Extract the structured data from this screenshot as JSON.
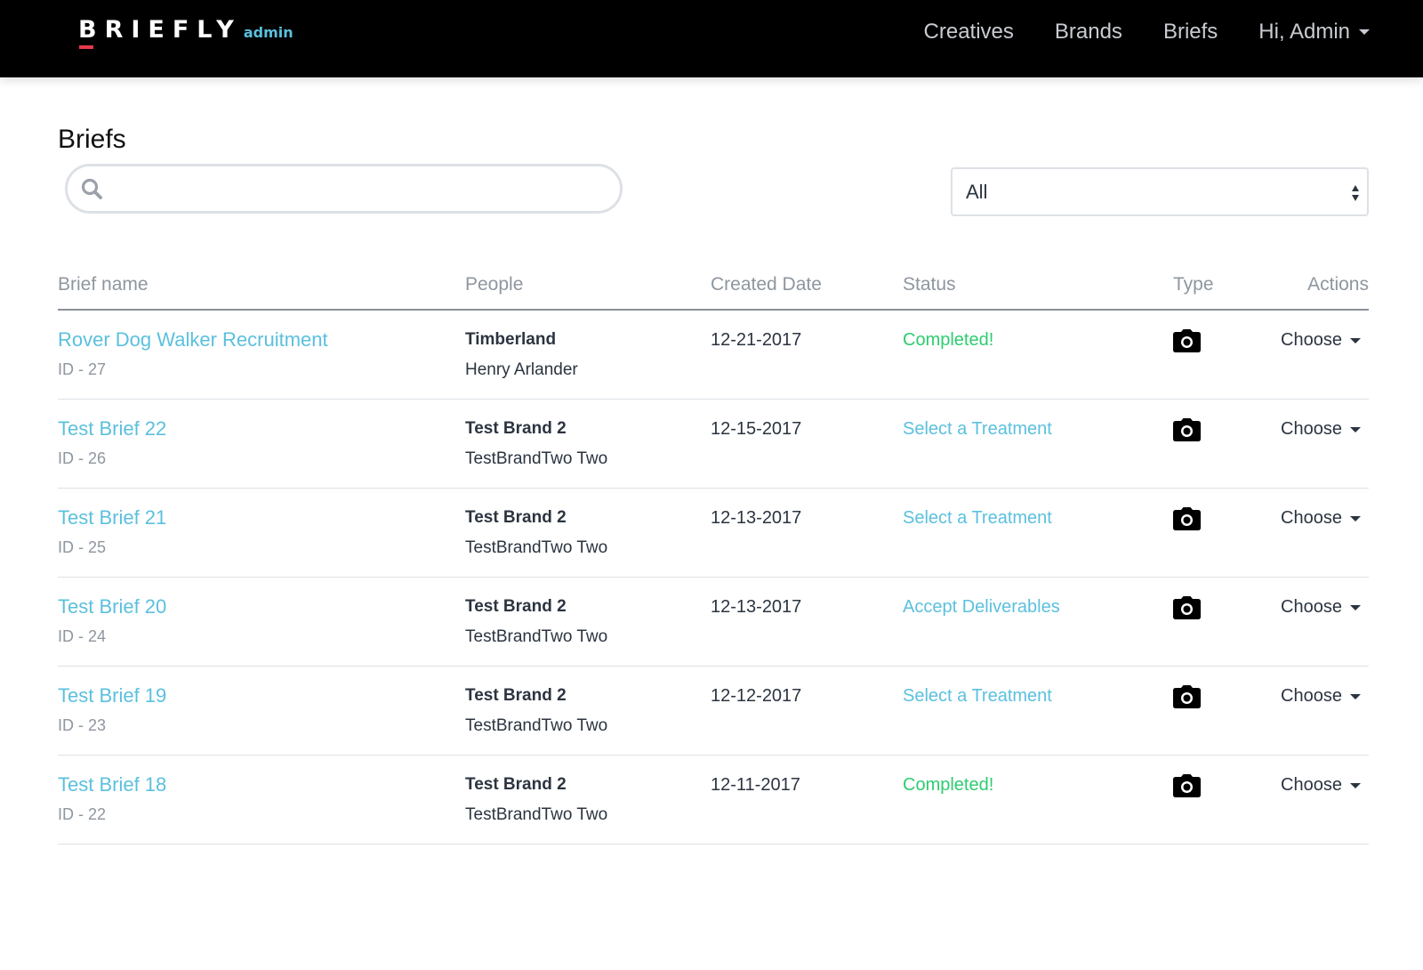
{
  "navbar": {
    "brand": "BRIEFLY",
    "brand_sub": "admin",
    "links": [
      "Creatives",
      "Brands",
      "Briefs"
    ],
    "user_menu": "Hi, Admin"
  },
  "page": {
    "title": "Briefs"
  },
  "search": {
    "placeholder": "",
    "value": ""
  },
  "filter": {
    "selected": "All"
  },
  "table": {
    "headers": {
      "name": "Brief name",
      "people": "People",
      "created": "Created Date",
      "status": "Status",
      "type": "Type",
      "actions": "Actions"
    },
    "rows": [
      {
        "name": "Rover Dog Walker Recruitment",
        "id": "ID - 27",
        "brand": "Timberland",
        "person": "Henry Arlander",
        "date": "12-21-2017",
        "status": "Completed!",
        "status_kind": "completed",
        "type_icon": "camera-icon",
        "action": "Choose"
      },
      {
        "name": "Test Brief 22",
        "id": "ID - 26",
        "brand": "Test Brand 2",
        "person": "TestBrandTwo Two",
        "date": "12-15-2017",
        "status": "Select a Treatment",
        "status_kind": "link",
        "type_icon": "camera-icon",
        "action": "Choose"
      },
      {
        "name": "Test Brief 21",
        "id": "ID - 25",
        "brand": "Test Brand 2",
        "person": "TestBrandTwo Two",
        "date": "12-13-2017",
        "status": "Select a Treatment",
        "status_kind": "link",
        "type_icon": "camera-icon",
        "action": "Choose"
      },
      {
        "name": "Test Brief 20",
        "id": "ID - 24",
        "brand": "Test Brand 2",
        "person": "TestBrandTwo Two",
        "date": "12-13-2017",
        "status": "Accept Deliverables",
        "status_kind": "link",
        "type_icon": "camera-icon",
        "action": "Choose"
      },
      {
        "name": "Test Brief 19",
        "id": "ID - 23",
        "brand": "Test Brand 2",
        "person": "TestBrandTwo Two",
        "date": "12-12-2017",
        "status": "Select a Treatment",
        "status_kind": "link",
        "type_icon": "camera-icon",
        "action": "Choose"
      },
      {
        "name": "Test Brief 18",
        "id": "ID - 22",
        "brand": "Test Brand 2",
        "person": "TestBrandTwo Two",
        "date": "12-11-2017",
        "status": "Completed!",
        "status_kind": "completed",
        "type_icon": "camera-icon",
        "action": "Choose"
      }
    ]
  },
  "colors": {
    "navbar_bg": "#000000",
    "brand_accent": "#e8394b",
    "link": "#5bc0de",
    "completed": "#2ecc71"
  }
}
